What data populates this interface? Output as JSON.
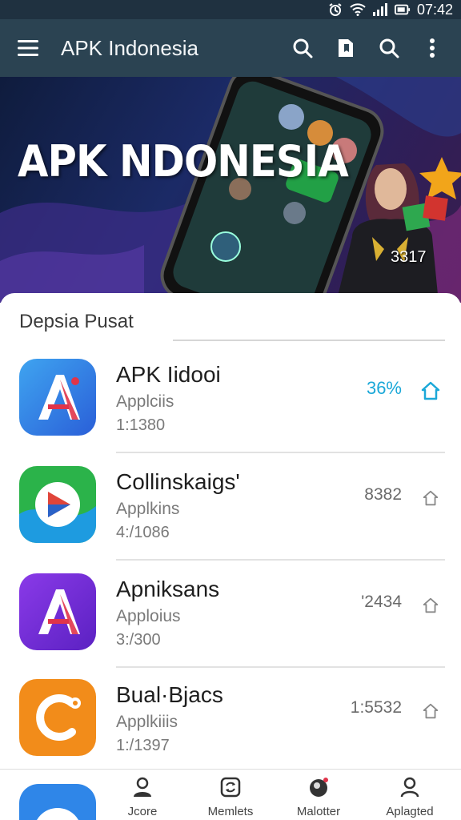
{
  "status_bar": {
    "time": "07:42",
    "icons": [
      "alarm-icon",
      "wifi-icon",
      "signal-icon",
      "battery-icon"
    ]
  },
  "app_bar": {
    "title": "APK Indonesia",
    "actions": [
      "search-icon",
      "bookmark-icon",
      "search-icon",
      "more-vert-icon"
    ]
  },
  "hero": {
    "title": "APK NDONESIA",
    "badge": "3317"
  },
  "section": {
    "title": "Depsia Pusat"
  },
  "apps": [
    {
      "name": "APK Iidooi",
      "category": "Applciis",
      "size": "1:1380",
      "stat": "36%",
      "icon": "a-logo-icon"
    },
    {
      "name": "Collinskaigs'",
      "category": "Applkins",
      "size": "4:/1086",
      "stat": "8382",
      "icon": "play-logo-icon"
    },
    {
      "name": "Apniksans",
      "category": "Apploius",
      "size": "3:/300",
      "stat": "'2434",
      "icon": "a-logo-icon"
    },
    {
      "name": "Bual·Bjacs",
      "category": "Applkiiis",
      "size": "1:/1397",
      "stat": "1:5532",
      "icon": "c-logo-icon"
    }
  ],
  "bottom_nav": [
    {
      "label": "Jcore",
      "icon": "person-icon"
    },
    {
      "label": "Memlets",
      "icon": "sync-icon"
    },
    {
      "label": "Malotter",
      "icon": "avatar-icon"
    },
    {
      "label": "Aplagted",
      "icon": "person-icon"
    }
  ],
  "colors": {
    "app_bar": "#2b4352",
    "accent": "#1ba8d8",
    "status_bar": "#1f3140"
  }
}
